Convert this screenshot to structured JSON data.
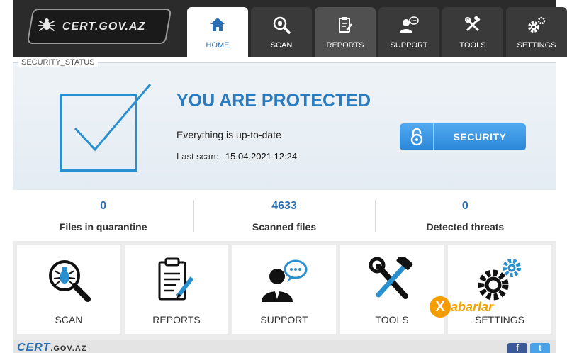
{
  "app": {
    "logo_text": "CERT.GOV.AZ"
  },
  "tabs": [
    {
      "label": "HOME",
      "icon": "home-icon",
      "active": true
    },
    {
      "label": "SCAN",
      "icon": "scan-bug-icon",
      "active": false
    },
    {
      "label": "REPORTS",
      "icon": "reports-icon",
      "active": false
    },
    {
      "label": "SUPPORT",
      "icon": "support-icon",
      "active": false
    },
    {
      "label": "TOOLS",
      "icon": "tools-icon",
      "active": false
    },
    {
      "label": "SETTINGS",
      "icon": "gears-icon",
      "active": false
    }
  ],
  "status": {
    "section_label": "SECURITY_STATUS",
    "title": "YOU ARE PROTECTED",
    "message": "Everything is up-to-date",
    "last_scan_label": "Last scan:",
    "last_scan_value": "15.04.2021  12:24",
    "security_button_label": "SECURITY"
  },
  "stats": [
    {
      "value": "0",
      "label": "Files in quarantine"
    },
    {
      "value": "4633",
      "label": "Scanned files"
    },
    {
      "value": "0",
      "label": "Detected threats"
    }
  ],
  "tiles": [
    {
      "label": "SCAN",
      "icon": "scan-bug-icon"
    },
    {
      "label": "REPORTS",
      "icon": "reports-icon"
    },
    {
      "label": "SUPPORT",
      "icon": "support-icon"
    },
    {
      "label": "TOOLS",
      "icon": "tools-icon"
    },
    {
      "label": "SETTINGS",
      "icon": "gears-icon"
    }
  ],
  "footer": {
    "logo_main": "CERT",
    "logo_small": ".GOV.AZ",
    "facebook": "f",
    "twitter": "t"
  },
  "watermark": {
    "badge": "X",
    "text": "abarlar"
  },
  "colors": {
    "accent": "#2a7bbf",
    "topbar": "#2b2b2b",
    "button": "#2a86d8"
  }
}
